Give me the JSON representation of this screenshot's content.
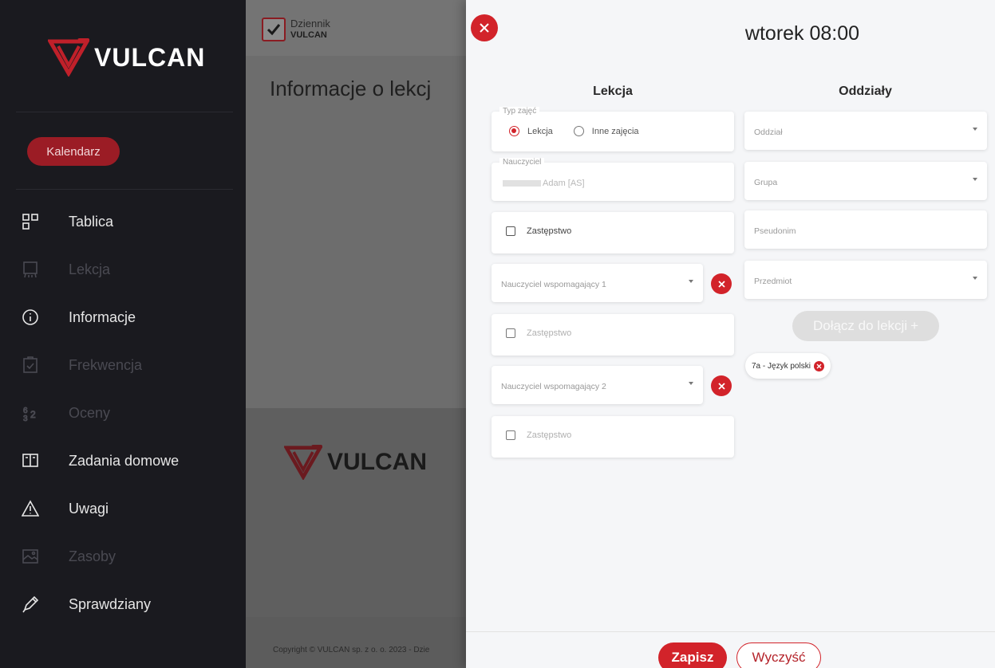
{
  "brand": {
    "logo_text": "VULCAN",
    "footer_logo_text": "VULCAN"
  },
  "sidebar": {
    "calendar_button": "Kalendarz",
    "items": [
      {
        "label": "Tablica",
        "icon": "dashboard-icon",
        "enabled": true
      },
      {
        "label": "Lekcja",
        "icon": "board-icon",
        "enabled": false
      },
      {
        "label": "Informacje",
        "icon": "info-icon",
        "enabled": true
      },
      {
        "label": "Frekwencja",
        "icon": "clipboard-icon",
        "enabled": false
      },
      {
        "label": "Oceny",
        "icon": "grades-icon",
        "enabled": false
      },
      {
        "label": "Zadania domowe",
        "icon": "book-icon",
        "enabled": true
      },
      {
        "label": "Uwagi",
        "icon": "warning-icon",
        "enabled": true
      },
      {
        "label": "Zasoby",
        "icon": "image-icon",
        "enabled": false
      },
      {
        "label": "Sprawdziany",
        "icon": "pen-icon",
        "enabled": true
      }
    ]
  },
  "background_page": {
    "app_name_line1": "Dziennik",
    "app_name_line2": "VULCAN",
    "title": "Informacje o lekcj",
    "copyright": "Copyright © VULCAN sp. z o. o. 2023 - Dzie"
  },
  "modal": {
    "title": "wtorek 08:00",
    "left_column": {
      "heading": "Lekcja",
      "type_legend": "Typ zajęć",
      "type_options": [
        "Lekcja",
        "Inne zajęcia"
      ],
      "type_selected": "Lekcja",
      "teacher_legend": "Nauczyciel",
      "teacher_value": "Adam [AS]",
      "substitution_label": "Zastępstwo",
      "assistant_1_placeholder": "Nauczyciel wspomagający 1",
      "assistant_2_placeholder": "Nauczyciel wspomagający 2"
    },
    "right_column": {
      "heading": "Oddziały",
      "class_placeholder": "Oddział",
      "group_placeholder": "Grupa",
      "alias_placeholder": "Pseudonim",
      "subject_placeholder": "Przedmiot",
      "join_button": "Dołącz do lekcji",
      "join_button_symbol": "+",
      "chips": [
        "7a - Język polski"
      ]
    },
    "footer": {
      "save_button": "Zapisz",
      "clear_button": "Wyczyść"
    }
  },
  "colors": {
    "accent": "#d2232a",
    "sidebar_bg": "#1a1a1f",
    "modal_bg": "#f5f6f8"
  }
}
